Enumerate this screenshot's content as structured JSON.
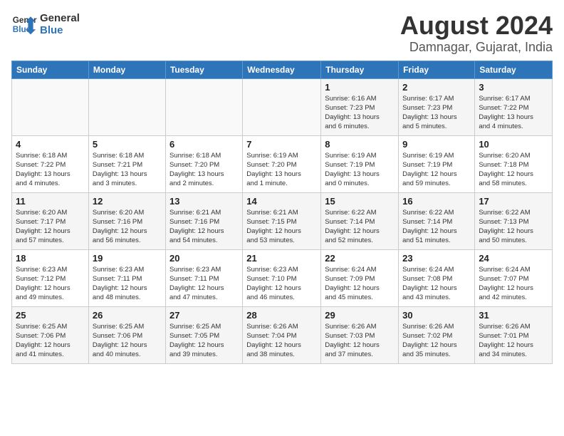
{
  "header": {
    "logo_line1": "General",
    "logo_line2": "Blue",
    "month_year": "August 2024",
    "location": "Damnagar, Gujarat, India"
  },
  "weekdays": [
    "Sunday",
    "Monday",
    "Tuesday",
    "Wednesday",
    "Thursday",
    "Friday",
    "Saturday"
  ],
  "weeks": [
    [
      {
        "day": "",
        "info": ""
      },
      {
        "day": "",
        "info": ""
      },
      {
        "day": "",
        "info": ""
      },
      {
        "day": "",
        "info": ""
      },
      {
        "day": "1",
        "info": "Sunrise: 6:16 AM\nSunset: 7:23 PM\nDaylight: 13 hours\nand 6 minutes."
      },
      {
        "day": "2",
        "info": "Sunrise: 6:17 AM\nSunset: 7:23 PM\nDaylight: 13 hours\nand 5 minutes."
      },
      {
        "day": "3",
        "info": "Sunrise: 6:17 AM\nSunset: 7:22 PM\nDaylight: 13 hours\nand 4 minutes."
      }
    ],
    [
      {
        "day": "4",
        "info": "Sunrise: 6:18 AM\nSunset: 7:22 PM\nDaylight: 13 hours\nand 4 minutes."
      },
      {
        "day": "5",
        "info": "Sunrise: 6:18 AM\nSunset: 7:21 PM\nDaylight: 13 hours\nand 3 minutes."
      },
      {
        "day": "6",
        "info": "Sunrise: 6:18 AM\nSunset: 7:20 PM\nDaylight: 13 hours\nand 2 minutes."
      },
      {
        "day": "7",
        "info": "Sunrise: 6:19 AM\nSunset: 7:20 PM\nDaylight: 13 hours\nand 1 minute."
      },
      {
        "day": "8",
        "info": "Sunrise: 6:19 AM\nSunset: 7:19 PM\nDaylight: 13 hours\nand 0 minutes."
      },
      {
        "day": "9",
        "info": "Sunrise: 6:19 AM\nSunset: 7:19 PM\nDaylight: 12 hours\nand 59 minutes."
      },
      {
        "day": "10",
        "info": "Sunrise: 6:20 AM\nSunset: 7:18 PM\nDaylight: 12 hours\nand 58 minutes."
      }
    ],
    [
      {
        "day": "11",
        "info": "Sunrise: 6:20 AM\nSunset: 7:17 PM\nDaylight: 12 hours\nand 57 minutes."
      },
      {
        "day": "12",
        "info": "Sunrise: 6:20 AM\nSunset: 7:16 PM\nDaylight: 12 hours\nand 56 minutes."
      },
      {
        "day": "13",
        "info": "Sunrise: 6:21 AM\nSunset: 7:16 PM\nDaylight: 12 hours\nand 54 minutes."
      },
      {
        "day": "14",
        "info": "Sunrise: 6:21 AM\nSunset: 7:15 PM\nDaylight: 12 hours\nand 53 minutes."
      },
      {
        "day": "15",
        "info": "Sunrise: 6:22 AM\nSunset: 7:14 PM\nDaylight: 12 hours\nand 52 minutes."
      },
      {
        "day": "16",
        "info": "Sunrise: 6:22 AM\nSunset: 7:14 PM\nDaylight: 12 hours\nand 51 minutes."
      },
      {
        "day": "17",
        "info": "Sunrise: 6:22 AM\nSunset: 7:13 PM\nDaylight: 12 hours\nand 50 minutes."
      }
    ],
    [
      {
        "day": "18",
        "info": "Sunrise: 6:23 AM\nSunset: 7:12 PM\nDaylight: 12 hours\nand 49 minutes."
      },
      {
        "day": "19",
        "info": "Sunrise: 6:23 AM\nSunset: 7:11 PM\nDaylight: 12 hours\nand 48 minutes."
      },
      {
        "day": "20",
        "info": "Sunrise: 6:23 AM\nSunset: 7:11 PM\nDaylight: 12 hours\nand 47 minutes."
      },
      {
        "day": "21",
        "info": "Sunrise: 6:23 AM\nSunset: 7:10 PM\nDaylight: 12 hours\nand 46 minutes."
      },
      {
        "day": "22",
        "info": "Sunrise: 6:24 AM\nSunset: 7:09 PM\nDaylight: 12 hours\nand 45 minutes."
      },
      {
        "day": "23",
        "info": "Sunrise: 6:24 AM\nSunset: 7:08 PM\nDaylight: 12 hours\nand 43 minutes."
      },
      {
        "day": "24",
        "info": "Sunrise: 6:24 AM\nSunset: 7:07 PM\nDaylight: 12 hours\nand 42 minutes."
      }
    ],
    [
      {
        "day": "25",
        "info": "Sunrise: 6:25 AM\nSunset: 7:06 PM\nDaylight: 12 hours\nand 41 minutes."
      },
      {
        "day": "26",
        "info": "Sunrise: 6:25 AM\nSunset: 7:06 PM\nDaylight: 12 hours\nand 40 minutes."
      },
      {
        "day": "27",
        "info": "Sunrise: 6:25 AM\nSunset: 7:05 PM\nDaylight: 12 hours\nand 39 minutes."
      },
      {
        "day": "28",
        "info": "Sunrise: 6:26 AM\nSunset: 7:04 PM\nDaylight: 12 hours\nand 38 minutes."
      },
      {
        "day": "29",
        "info": "Sunrise: 6:26 AM\nSunset: 7:03 PM\nDaylight: 12 hours\nand 37 minutes."
      },
      {
        "day": "30",
        "info": "Sunrise: 6:26 AM\nSunset: 7:02 PM\nDaylight: 12 hours\nand 35 minutes."
      },
      {
        "day": "31",
        "info": "Sunrise: 6:26 AM\nSunset: 7:01 PM\nDaylight: 12 hours\nand 34 minutes."
      }
    ]
  ]
}
